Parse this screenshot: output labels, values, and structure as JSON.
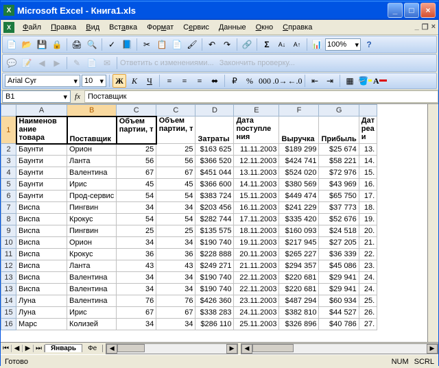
{
  "window": {
    "app": "Microsoft Excel",
    "doc": "Книга1.xls"
  },
  "menus": [
    "Файл",
    "Правка",
    "Вид",
    "Вставка",
    "Формат",
    "Сервис",
    "Данные",
    "Окно",
    "Справка"
  ],
  "zoom": "100%",
  "review": {
    "reply": "Ответить с изменениями...",
    "end": "Закончить проверку..."
  },
  "font": {
    "name": "Arial Cyr",
    "size": "10"
  },
  "namebox": "B1",
  "formula": "Поставщик",
  "cols": [
    "A",
    "B",
    "C",
    "C",
    "D",
    "E",
    "F",
    "G"
  ],
  "headers": {
    "A": "Наименование товара",
    "B": "Поставщик",
    "C1": "Объем партии, т",
    "C2": "Объем партии, т",
    "D": "Затраты",
    "E": "Дата поступления",
    "F": "Выручка",
    "G": "Прибыль",
    "H": "Дата реализации"
  },
  "rows": [
    {
      "n": 2,
      "a": "Баунти",
      "b": "Орион",
      "c1": "25",
      "c2": "25",
      "d": "$163 625",
      "e": "11.11.2003",
      "f": "$189 299",
      "g": "$25 674",
      "h": "13."
    },
    {
      "n": 3,
      "a": "Баунти",
      "b": "Ланта",
      "c1": "56",
      "c2": "56",
      "d": "$366 520",
      "e": "12.11.2003",
      "f": "$424 741",
      "g": "$58 221",
      "h": "14."
    },
    {
      "n": 4,
      "a": "Баунти",
      "b": "Валентина",
      "c1": "67",
      "c2": "67",
      "d": "$451 044",
      "e": "13.11.2003",
      "f": "$524 020",
      "g": "$72 976",
      "h": "15."
    },
    {
      "n": 5,
      "a": "Баунти",
      "b": "Ирис",
      "c1": "45",
      "c2": "45",
      "d": "$366 600",
      "e": "14.11.2003",
      "f": "$380 569",
      "g": "$43 969",
      "h": "16."
    },
    {
      "n": 6,
      "a": "Баунти",
      "b": "Прод-сервис",
      "c1": "54",
      "c2": "54",
      "d": "$383 724",
      "e": "15.11.2003",
      "f": "$449 474",
      "g": "$65 750",
      "h": "17."
    },
    {
      "n": 7,
      "a": "Виспа",
      "b": "Пингвин",
      "c1": "34",
      "c2": "34",
      "d": "$203 456",
      "e": "16.11.2003",
      "f": "$241 229",
      "g": "$37 773",
      "h": "18."
    },
    {
      "n": 8,
      "a": "Виспа",
      "b": "Крокус",
      "c1": "54",
      "c2": "54",
      "d": "$282 744",
      "e": "17.11.2003",
      "f": "$335 420",
      "g": "$52 676",
      "h": "19."
    },
    {
      "n": 9,
      "a": "Виспа",
      "b": "Пингвин",
      "c1": "25",
      "c2": "25",
      "d": "$135 575",
      "e": "18.11.2003",
      "f": "$160 093",
      "g": "$24 518",
      "h": "20."
    },
    {
      "n": 10,
      "a": "Виспа",
      "b": "Орион",
      "c1": "34",
      "c2": "34",
      "d": "$190 740",
      "e": "19.11.2003",
      "f": "$217 945",
      "g": "$27 205",
      "h": "21."
    },
    {
      "n": 11,
      "a": "Виспа",
      "b": "Крокус",
      "c1": "36",
      "c2": "36",
      "d": "$228 888",
      "e": "20.11.2003",
      "f": "$265 227",
      "g": "$36 339",
      "h": "22."
    },
    {
      "n": 12,
      "a": "Виспа",
      "b": "Ланта",
      "c1": "43",
      "c2": "43",
      "d": "$249 271",
      "e": "21.11.2003",
      "f": "$294 357",
      "g": "$45 086",
      "h": "23."
    },
    {
      "n": 13,
      "a": "Виспа",
      "b": "Валентина",
      "c1": "34",
      "c2": "34",
      "d": "$190 740",
      "e": "22.11.2003",
      "f": "$220 681",
      "g": "$29 941",
      "h": "24."
    },
    {
      "n": "13b",
      "a": "Виспа",
      "b": "Валентина",
      "c1": "34",
      "c2": "34",
      "d": "$190 740",
      "e": "22.11.2003",
      "f": "$220 681",
      "g": "$29 941",
      "h": "24."
    },
    {
      "n": 14,
      "a": "Луна",
      "b": "Валентина",
      "c1": "76",
      "c2": "76",
      "d": "$426 360",
      "e": "23.11.2003",
      "f": "$487 294",
      "g": "$60 934",
      "h": "25."
    },
    {
      "n": 15,
      "a": "Луна",
      "b": "Ирис",
      "c1": "67",
      "c2": "67",
      "d": "$338 283",
      "e": "24.11.2003",
      "f": "$382 810",
      "g": "$44 527",
      "h": "26."
    },
    {
      "n": 16,
      "a": "Марс",
      "b": "Колизей",
      "c1": "34",
      "c2": "34",
      "d": "$286 110",
      "e": "25.11.2003",
      "f": "$326 896",
      "g": "$40 786",
      "h": "27."
    }
  ],
  "sheet_tabs": {
    "active": "Январь",
    "next": "Фе"
  },
  "status": {
    "ready": "Готово",
    "num": "NUM",
    "scrl": "SCRL"
  },
  "colw": {
    "A": 74,
    "B": 72,
    "C1": 58,
    "C2": 56,
    "D": 56,
    "E": 66,
    "F": 58,
    "G": 52,
    "H": 26
  }
}
